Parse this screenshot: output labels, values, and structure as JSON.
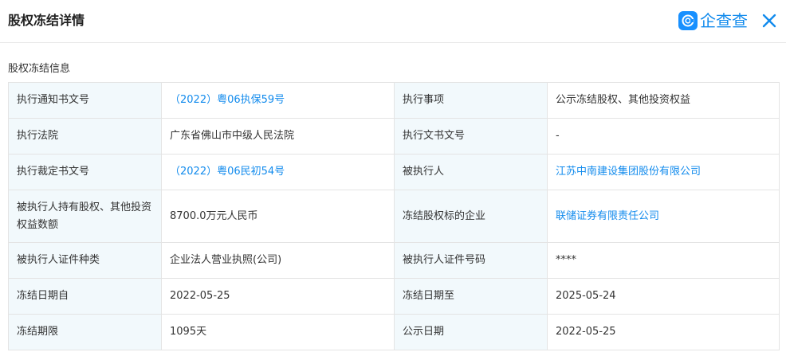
{
  "header": {
    "title": "股权冻结详情",
    "brand_name": "企查查",
    "brand_color": "#128bed",
    "close_icon": "close-icon"
  },
  "section_title": "股权冻结信息",
  "rows": [
    {
      "left": {
        "label": "执行通知书文号",
        "value": "（2022）粤06执保59号",
        "link": true
      },
      "right": {
        "label": "执行事项",
        "value": "公示冻结股权、其他投资权益",
        "link": false
      }
    },
    {
      "left": {
        "label": "执行法院",
        "value": "广东省佛山市中级人民法院",
        "link": false
      },
      "right": {
        "label": "执行文书文号",
        "value": "-",
        "link": false
      }
    },
    {
      "left": {
        "label": "执行裁定书文号",
        "value": "（2022）粤06民初54号",
        "link": true
      },
      "right": {
        "label": "被执行人",
        "value": "江苏中南建设集团股份有限公司",
        "link": true
      }
    },
    {
      "left": {
        "label": "被执行人持有股权、其他投资权益数额",
        "value": "8700.0万元人民币",
        "link": false
      },
      "right": {
        "label": "冻结股权标的企业",
        "value": "联储证券有限责任公司",
        "link": true
      }
    },
    {
      "left": {
        "label": "被执行人证件种类",
        "value": "企业法人营业执照(公司)",
        "link": false
      },
      "right": {
        "label": "被执行人证件号码",
        "value": "****",
        "link": false
      }
    },
    {
      "left": {
        "label": "冻结日期自",
        "value": "2022-05-25",
        "link": false
      },
      "right": {
        "label": "冻结日期至",
        "value": "2025-05-24",
        "link": false
      }
    },
    {
      "left": {
        "label": "冻结期限",
        "value": "1095天",
        "link": false
      },
      "right": {
        "label": "公示日期",
        "value": "2022-05-25",
        "link": false
      }
    }
  ]
}
